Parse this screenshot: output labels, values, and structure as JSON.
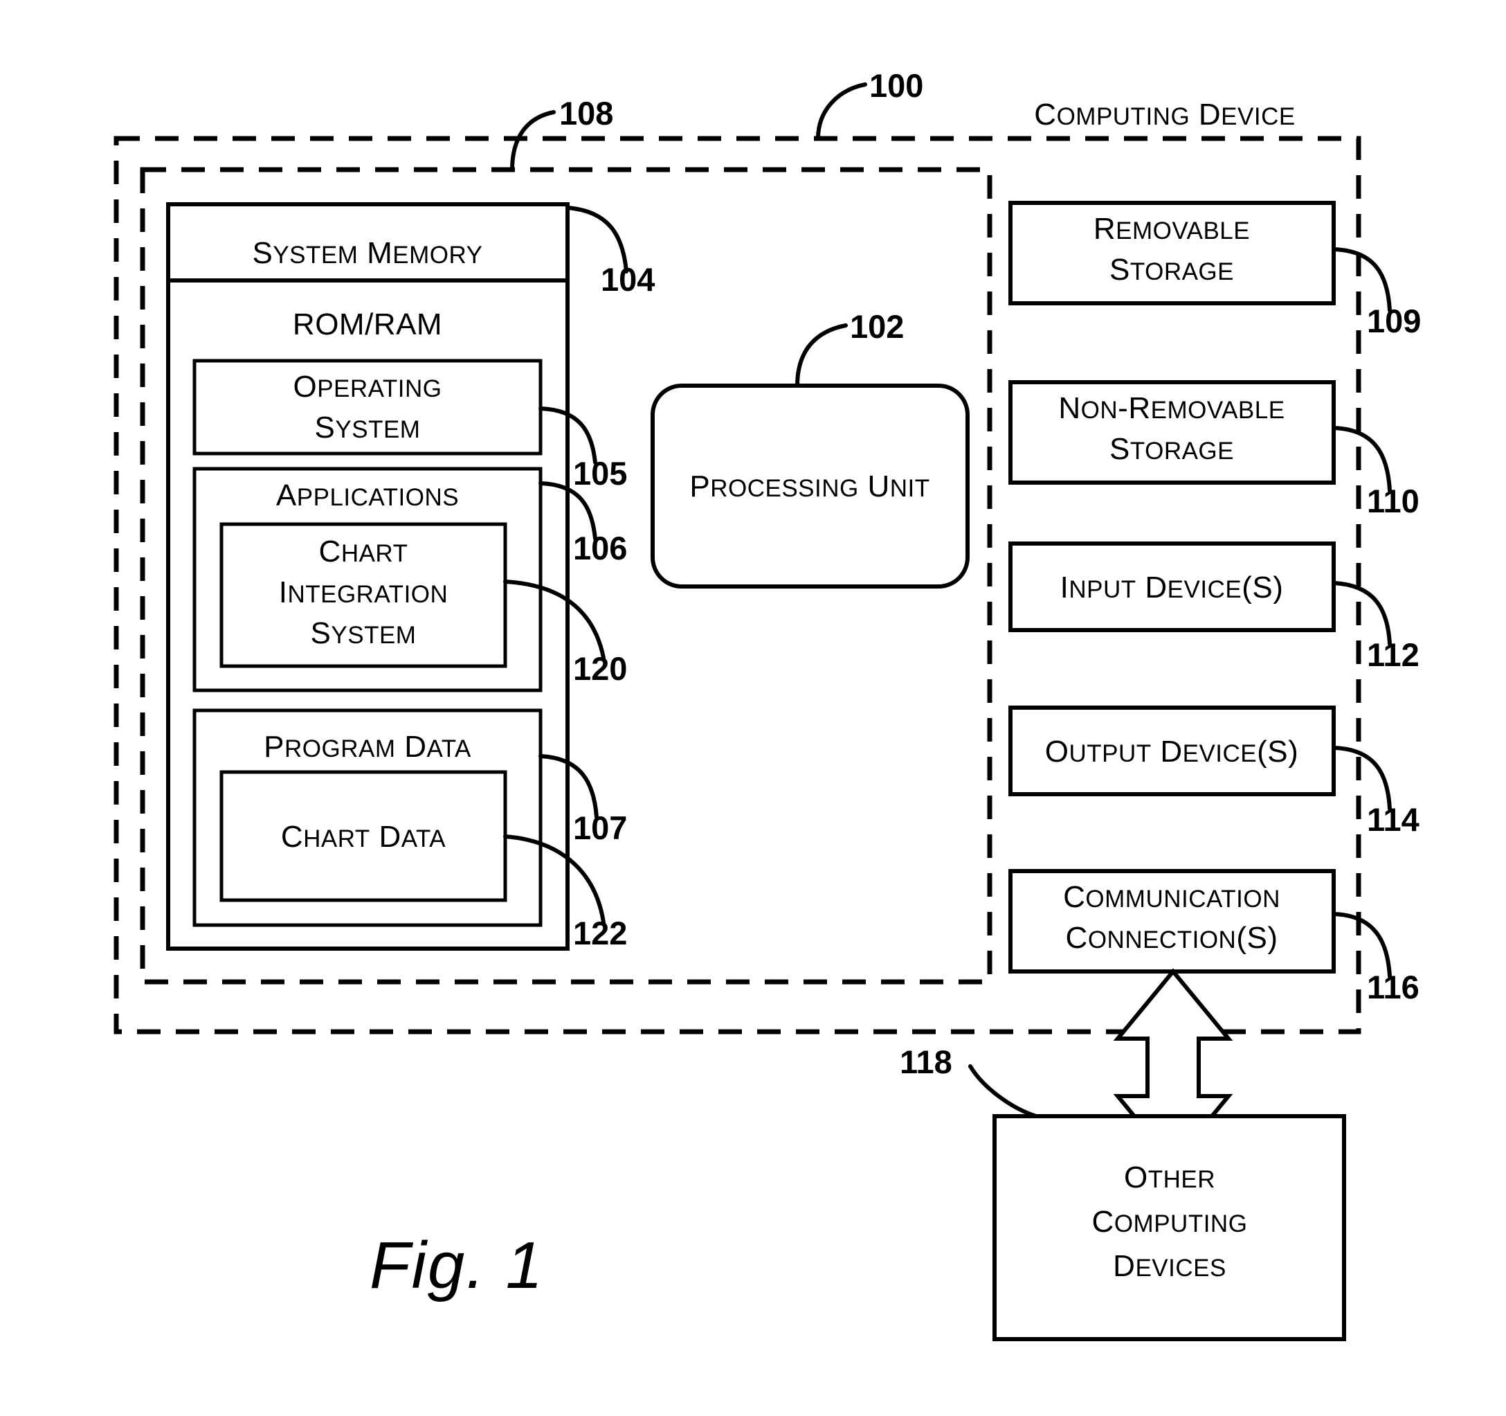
{
  "figure": {
    "caption": "Fig. 1",
    "title": "COMPUTING DEVICE"
  },
  "reference_numerals": {
    "device": "100",
    "processing_unit": "102",
    "system_memory": "104",
    "operating_system": "105",
    "applications": "106",
    "program_data": "107",
    "basic_configuration": "108",
    "removable_storage": "109",
    "non_removable_storage": "110",
    "input_devices": "112",
    "output_devices": "114",
    "communication_connections": "116",
    "other_computing_devices": "118",
    "chart_integration_system": "120",
    "chart_data": "122"
  },
  "memory": {
    "header": "SYSTEM MEMORY",
    "rom_ram": "ROM/RAM",
    "operating_system": {
      "line1": "OPERATING",
      "line2": "SYSTEM"
    },
    "applications": {
      "label": "APPLICATIONS"
    },
    "chart_integration_system": {
      "line1": "CHART",
      "line2": "INTEGRATION",
      "line3": "SYSTEM"
    },
    "program_data": {
      "label": "PROGRAM DATA"
    },
    "chart_data": {
      "label": "CHART DATA"
    }
  },
  "processing_unit": {
    "label": "PROCESSING UNIT"
  },
  "peripherals": [
    {
      "id": "removable-storage",
      "line1": "REMOVABLE",
      "line2": "STORAGE",
      "ref": "109"
    },
    {
      "id": "non-removable-storage",
      "line1": "NON-REMOVABLE",
      "line2": "STORAGE",
      "ref": "110"
    },
    {
      "id": "input-devices",
      "line1": "INPUT DEVICE(S)",
      "line2": "",
      "ref": "112"
    },
    {
      "id": "output-devices",
      "line1": "OUTPUT DEVICE(S)",
      "line2": "",
      "ref": "114"
    },
    {
      "id": "communication-connections",
      "line1": "COMMUNICATION",
      "line2": "CONNECTION(S)",
      "ref": "116"
    }
  ],
  "other_devices": {
    "line1": "OTHER",
    "line2": "COMPUTING",
    "line3": "DEVICES"
  },
  "colors": {
    "ink": "#000000",
    "paper": "#ffffff"
  }
}
